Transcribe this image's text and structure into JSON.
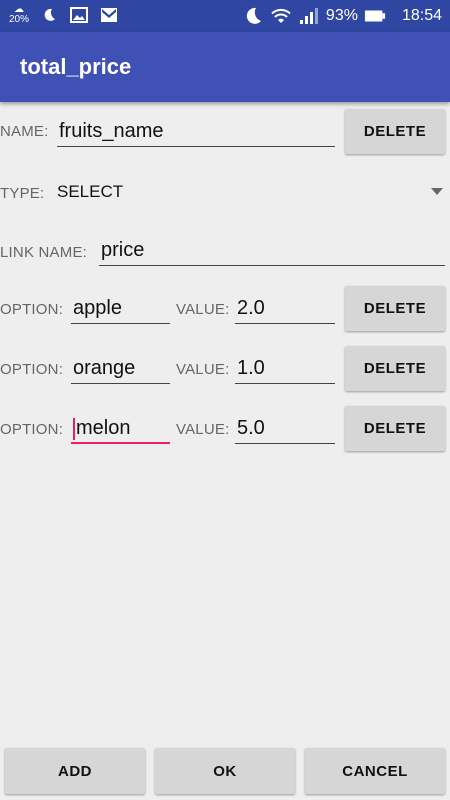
{
  "status": {
    "battery": "93%",
    "time": "18:54",
    "weather_temp": "20%"
  },
  "appbar": {
    "title": "total_price"
  },
  "name_row": {
    "label": "NAME:",
    "value": "fruits_name",
    "delete": "DELETE"
  },
  "type_row": {
    "label": "TYPE:",
    "value": "SELECT"
  },
  "link_row": {
    "label": "LINK NAME:",
    "value": "price"
  },
  "options": [
    {
      "option_label": "OPTION:",
      "option_value": "apple",
      "value_label": "VALUE:",
      "value": "2.0",
      "delete": "DELETE"
    },
    {
      "option_label": "OPTION:",
      "option_value": "orange",
      "value_label": "VALUE:",
      "value": "1.0",
      "delete": "DELETE"
    },
    {
      "option_label": "OPTION:",
      "option_value": "melon",
      "value_label": "VALUE:",
      "value": "5.0",
      "delete": "DELETE"
    }
  ],
  "buttons": {
    "add": "ADD",
    "ok": "OK",
    "cancel": "CANCEL"
  },
  "colors": {
    "statusbar": "#2f47a3",
    "appbar": "#3f51b5",
    "accent": "#e91e63",
    "background": "#eeeeee"
  }
}
